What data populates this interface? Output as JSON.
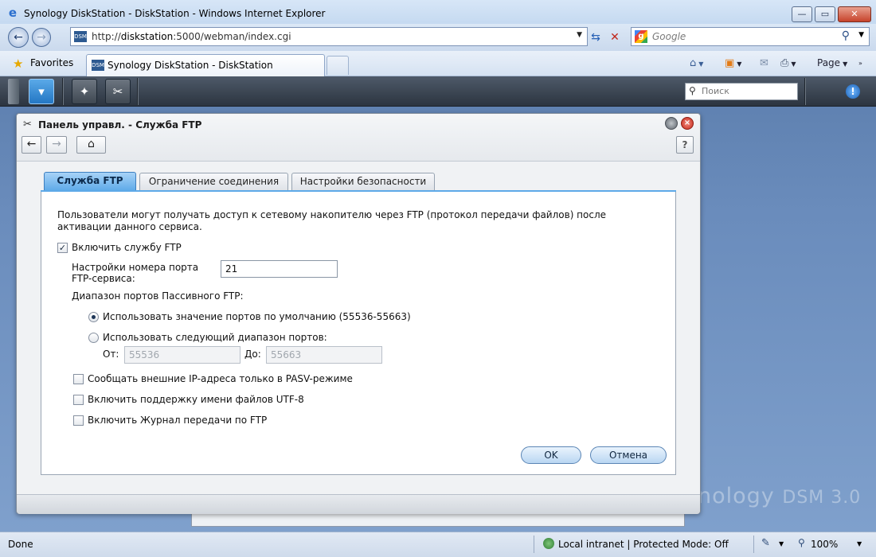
{
  "browser": {
    "title": "Synology DiskStation - DiskStation - Windows Internet Explorer",
    "url_prefix": "http://",
    "url_host": "diskstation",
    "url_rest": ":5000/webman/index.cgi",
    "search_placeholder": "Google",
    "favorites_label": "Favorites",
    "tab_title": "Synology DiskStation - DiskStation",
    "page_menu_label": "Page",
    "favicon_text": "DSM"
  },
  "dsm": {
    "search_placeholder": "Поиск",
    "watermark_brand": "nology",
    "watermark_version": "DSM 3.0"
  },
  "window": {
    "title": "Панель управл. - Служба FTP",
    "help_label": "?"
  },
  "tabs": [
    {
      "label": "Служба FTP",
      "active": true
    },
    {
      "label": "Ограничение соединения",
      "active": false
    },
    {
      "label": "Настройки безопасности",
      "active": false
    }
  ],
  "form": {
    "description": "Пользователи могут получать доступ к сетевому накопителю через FTP (протокол передачи файлов) после активации данного сервиса.",
    "enable_ftp": {
      "label": "Включить службу FTP",
      "checked": true
    },
    "port_label_line1": "Настройки номера порта",
    "port_label_line2": "FTP-сервиса:",
    "port_value": "21",
    "passive_range_label": "Диапазон портов Пассивного FTP:",
    "radio_default": {
      "label": "Использовать значение портов по умолчанию (55536-55663)",
      "selected": true
    },
    "radio_custom": {
      "label": "Использовать следующий диапазон портов:",
      "selected": false
    },
    "from_label": "От:",
    "from_value": "55536",
    "to_label": "До:",
    "to_value": "55663",
    "pasv_external_ip": {
      "label": "Сообщать внешние IP-адреса только в PASV-режиме",
      "checked": false
    },
    "utf8_support": {
      "label": "Включить поддержку имени файлов UTF-8",
      "checked": false
    },
    "transfer_log": {
      "label": "Включить Журнал передачи по FTP",
      "checked": false
    },
    "ok_label": "OK",
    "cancel_label": "Отмена"
  },
  "statusbar": {
    "status": "Done",
    "zone": "Local intranet | Protected Mode: Off",
    "zoom": "100%"
  },
  "colors": {
    "active_tab": "#5da9e8",
    "dsm_background": "#6a8cbc",
    "taskbar": "#3a4450"
  }
}
